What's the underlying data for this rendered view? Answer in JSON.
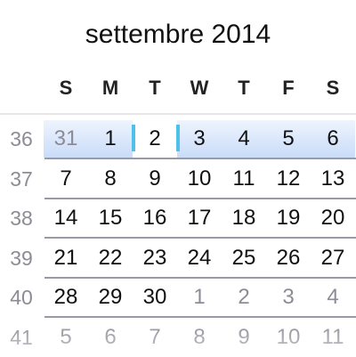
{
  "title": "settembre 2014",
  "weekdays": [
    "S",
    "M",
    "T",
    "W",
    "T",
    "F",
    "S"
  ],
  "selected_week": 36,
  "selected_date": "2",
  "colors": {
    "accent": "#4fc0ea",
    "selected_week_bg": "#c9dcf8",
    "other_month": "#8c8c96"
  },
  "weeks": [
    {
      "number": "36",
      "days": [
        {
          "d": "31",
          "other": true
        },
        {
          "d": "1"
        },
        {
          "d": "2",
          "selected": true
        },
        {
          "d": "3"
        },
        {
          "d": "4"
        },
        {
          "d": "5"
        },
        {
          "d": "6"
        }
      ]
    },
    {
      "number": "37",
      "days": [
        {
          "d": "7"
        },
        {
          "d": "8"
        },
        {
          "d": "9"
        },
        {
          "d": "10"
        },
        {
          "d": "11"
        },
        {
          "d": "12"
        },
        {
          "d": "13"
        }
      ]
    },
    {
      "number": "38",
      "days": [
        {
          "d": "14"
        },
        {
          "d": "15"
        },
        {
          "d": "16"
        },
        {
          "d": "17"
        },
        {
          "d": "18"
        },
        {
          "d": "19"
        },
        {
          "d": "20"
        }
      ]
    },
    {
      "number": "39",
      "days": [
        {
          "d": "21"
        },
        {
          "d": "22"
        },
        {
          "d": "23"
        },
        {
          "d": "24"
        },
        {
          "d": "25"
        },
        {
          "d": "26"
        },
        {
          "d": "27"
        }
      ]
    },
    {
      "number": "40",
      "days": [
        {
          "d": "28"
        },
        {
          "d": "29"
        },
        {
          "d": "30"
        },
        {
          "d": "1",
          "other": true
        },
        {
          "d": "2",
          "other": true
        },
        {
          "d": "3",
          "other": true
        },
        {
          "d": "4",
          "other": true
        }
      ]
    },
    {
      "number": "41",
      "days": [
        {
          "d": "5",
          "other": true
        },
        {
          "d": "6",
          "other": true
        },
        {
          "d": "7",
          "other": true
        },
        {
          "d": "8",
          "other": true
        },
        {
          "d": "9",
          "other": true
        },
        {
          "d": "10",
          "other": true
        },
        {
          "d": "11",
          "other": true
        }
      ]
    }
  ]
}
